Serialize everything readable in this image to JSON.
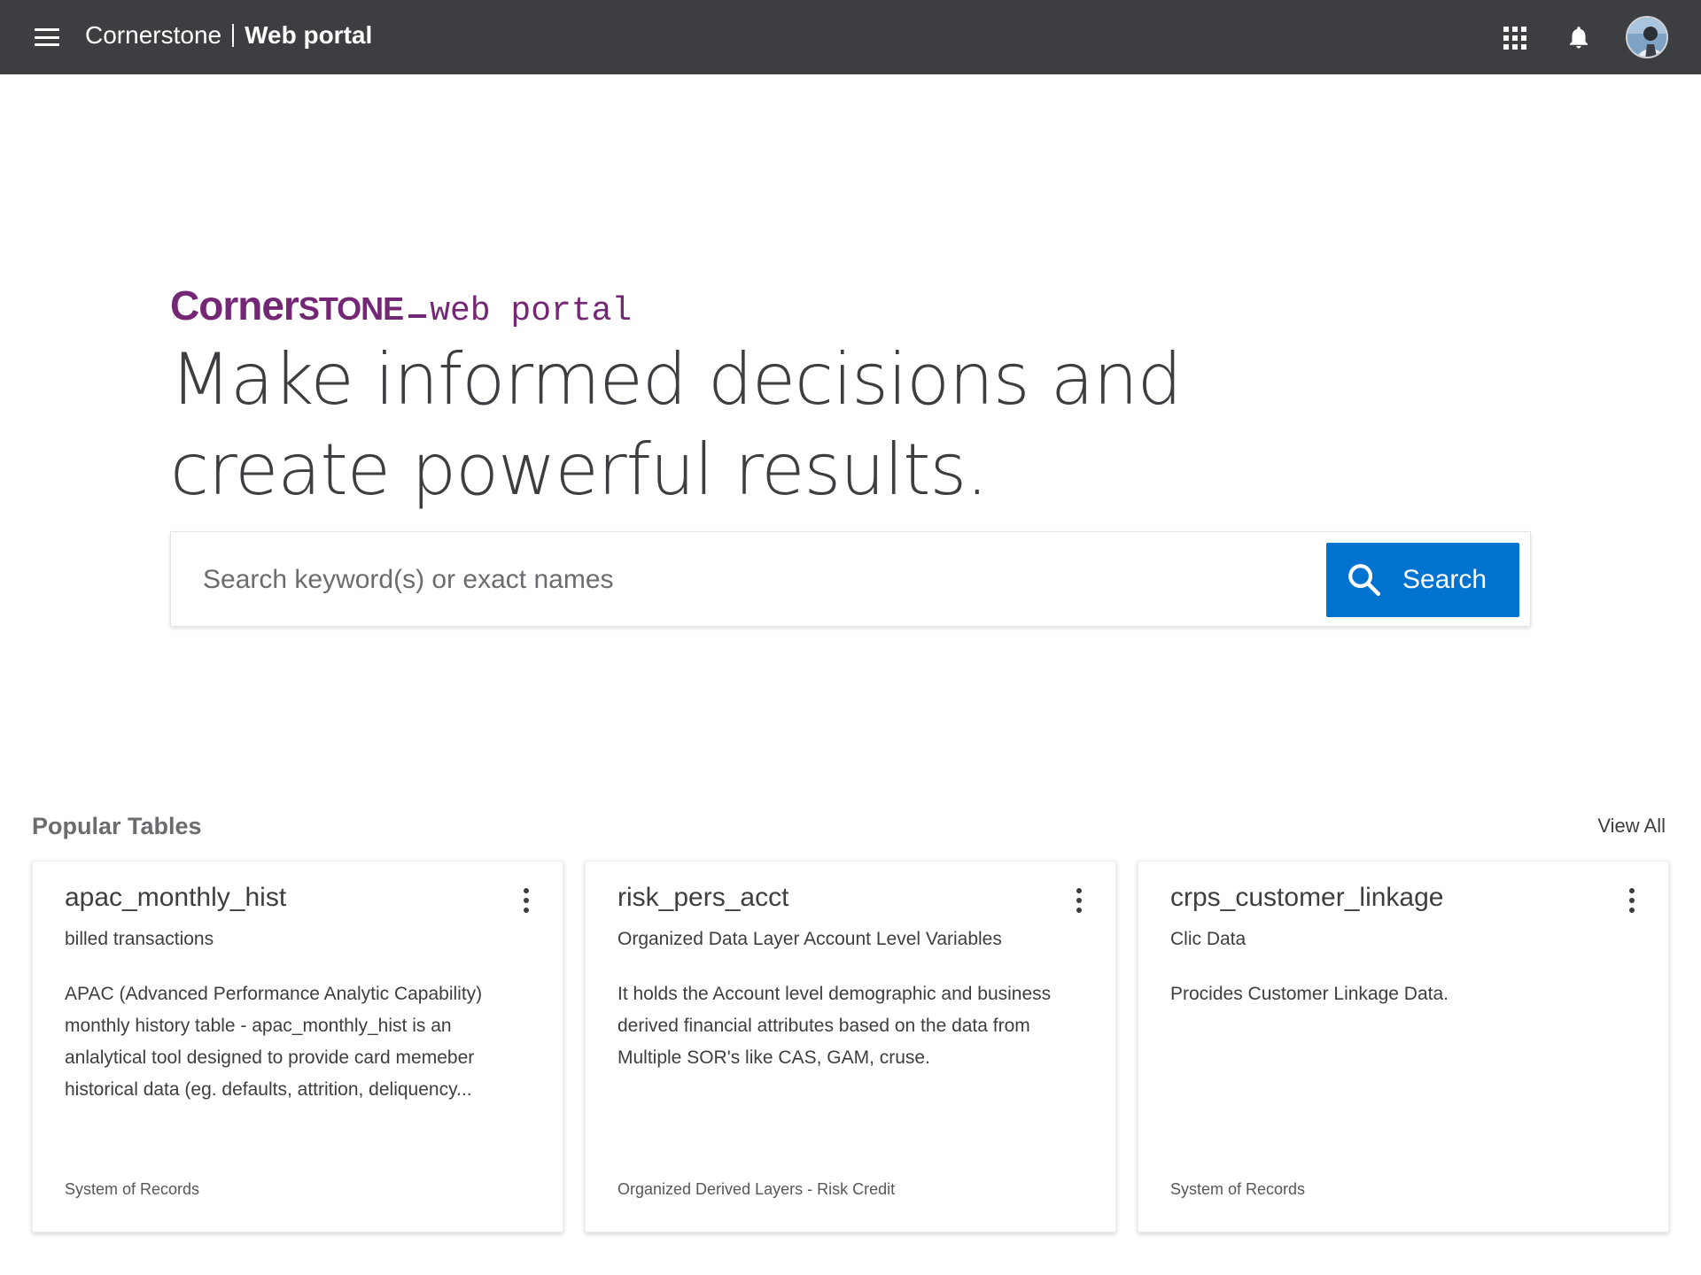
{
  "header": {
    "app_name": "Cornerstone",
    "app_section": "Web portal"
  },
  "hero": {
    "brand_corner": "Corner",
    "brand_stone": "STONE",
    "brand_suffix": "web portal",
    "headline_line1": "Make informed decisions and",
    "headline_line2": "create powerful results."
  },
  "search": {
    "placeholder": "Search keyword(s) or exact names",
    "button_label": "Search"
  },
  "popular": {
    "title": "Popular Tables",
    "view_all": "View All",
    "cards": [
      {
        "name": "apac_monthly_hist",
        "subtitle": "billed transactions",
        "description": "APAC (Advanced Performance Analytic Capability) monthly history table - apac_monthly_hist is an anlalytical tool designed to provide card memeber historical data (eg. defaults, attrition, deliquency...",
        "source": "System of Records"
      },
      {
        "name": "risk_pers_acct",
        "subtitle": "Organized Data Layer Account Level Variables",
        "description": "It holds the Account level demographic and business derived financial attributes based on the data from Multiple SOR's like CAS, GAM, cruse.",
        "source": "Organized Derived Layers - Risk Credit"
      },
      {
        "name": "crps_customer_linkage",
        "subtitle": "Clic Data",
        "description": "Procides Customer Linkage Data.",
        "source": "System of Records"
      }
    ]
  },
  "colors": {
    "topbar": "#3d3e41",
    "brand": "#742774",
    "accent": "#0073d1"
  },
  "icons": [
    "menu-icon",
    "apps-grid-icon",
    "bell-icon",
    "avatar",
    "search-icon",
    "more-vert-icon"
  ]
}
